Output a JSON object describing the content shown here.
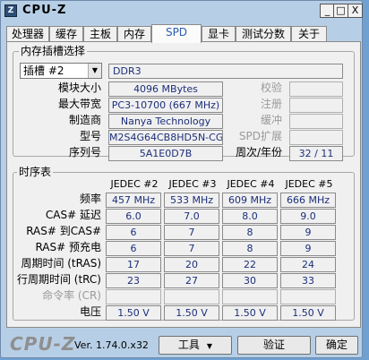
{
  "window": {
    "title": "CPU-Z",
    "icon_glyph": "Z",
    "min": "_",
    "max": "□",
    "close": "X"
  },
  "tabs": [
    "处理器",
    "缓存",
    "主板",
    "内存",
    "SPD",
    "显卡",
    "测试分数",
    "关于"
  ],
  "active_tab": "SPD",
  "slot_group": {
    "title": "内存插槽选择",
    "slot_select": "插槽 #2",
    "mem_type": "DDR3",
    "labels": [
      "模块大小",
      "最大带宽",
      "制造商",
      "型号",
      "序列号"
    ],
    "values": [
      "4096 MBytes",
      "PC3-10700 (667 MHz)",
      "Nanya Technology",
      "M2S4G64CB8HD5N-CG",
      "5A1E0D7B"
    ],
    "right_labels": [
      "校验",
      "注册",
      "缓冲",
      "SPD扩展",
      "周次/年份"
    ],
    "week_year": "32 / 11"
  },
  "timings": {
    "title": "时序表",
    "columns": [
      "JEDEC #2",
      "JEDEC #3",
      "JEDEC #4",
      "JEDEC #5"
    ],
    "rows": [
      {
        "label": "频率",
        "dim": false,
        "values": [
          "457 MHz",
          "533 MHz",
          "609 MHz",
          "666 MHz"
        ]
      },
      {
        "label": "CAS# 延迟",
        "dim": false,
        "values": [
          "6.0",
          "7.0",
          "8.0",
          "9.0"
        ]
      },
      {
        "label": "RAS# 到CAS#",
        "dim": false,
        "values": [
          "6",
          "7",
          "8",
          "9"
        ]
      },
      {
        "label": "RAS# 预充电",
        "dim": false,
        "values": [
          "6",
          "7",
          "8",
          "9"
        ]
      },
      {
        "label": "周期时间 (tRAS)",
        "dim": false,
        "values": [
          "17",
          "20",
          "22",
          "24"
        ]
      },
      {
        "label": "行周期时间 (tRC)",
        "dim": false,
        "values": [
          "23",
          "27",
          "30",
          "33"
        ]
      },
      {
        "label": "命令率 (CR)",
        "dim": true,
        "values": [
          "",
          "",
          "",
          ""
        ]
      },
      {
        "label": "电压",
        "dim": false,
        "values": [
          "1.50 V",
          "1.50 V",
          "1.50 V",
          "1.50 V"
        ]
      }
    ]
  },
  "footer": {
    "logo": "CPU-Z",
    "version": "Ver. 1.74.0.x32",
    "tools_label": "工具",
    "validate_label": "验证",
    "ok_label": "确定"
  }
}
